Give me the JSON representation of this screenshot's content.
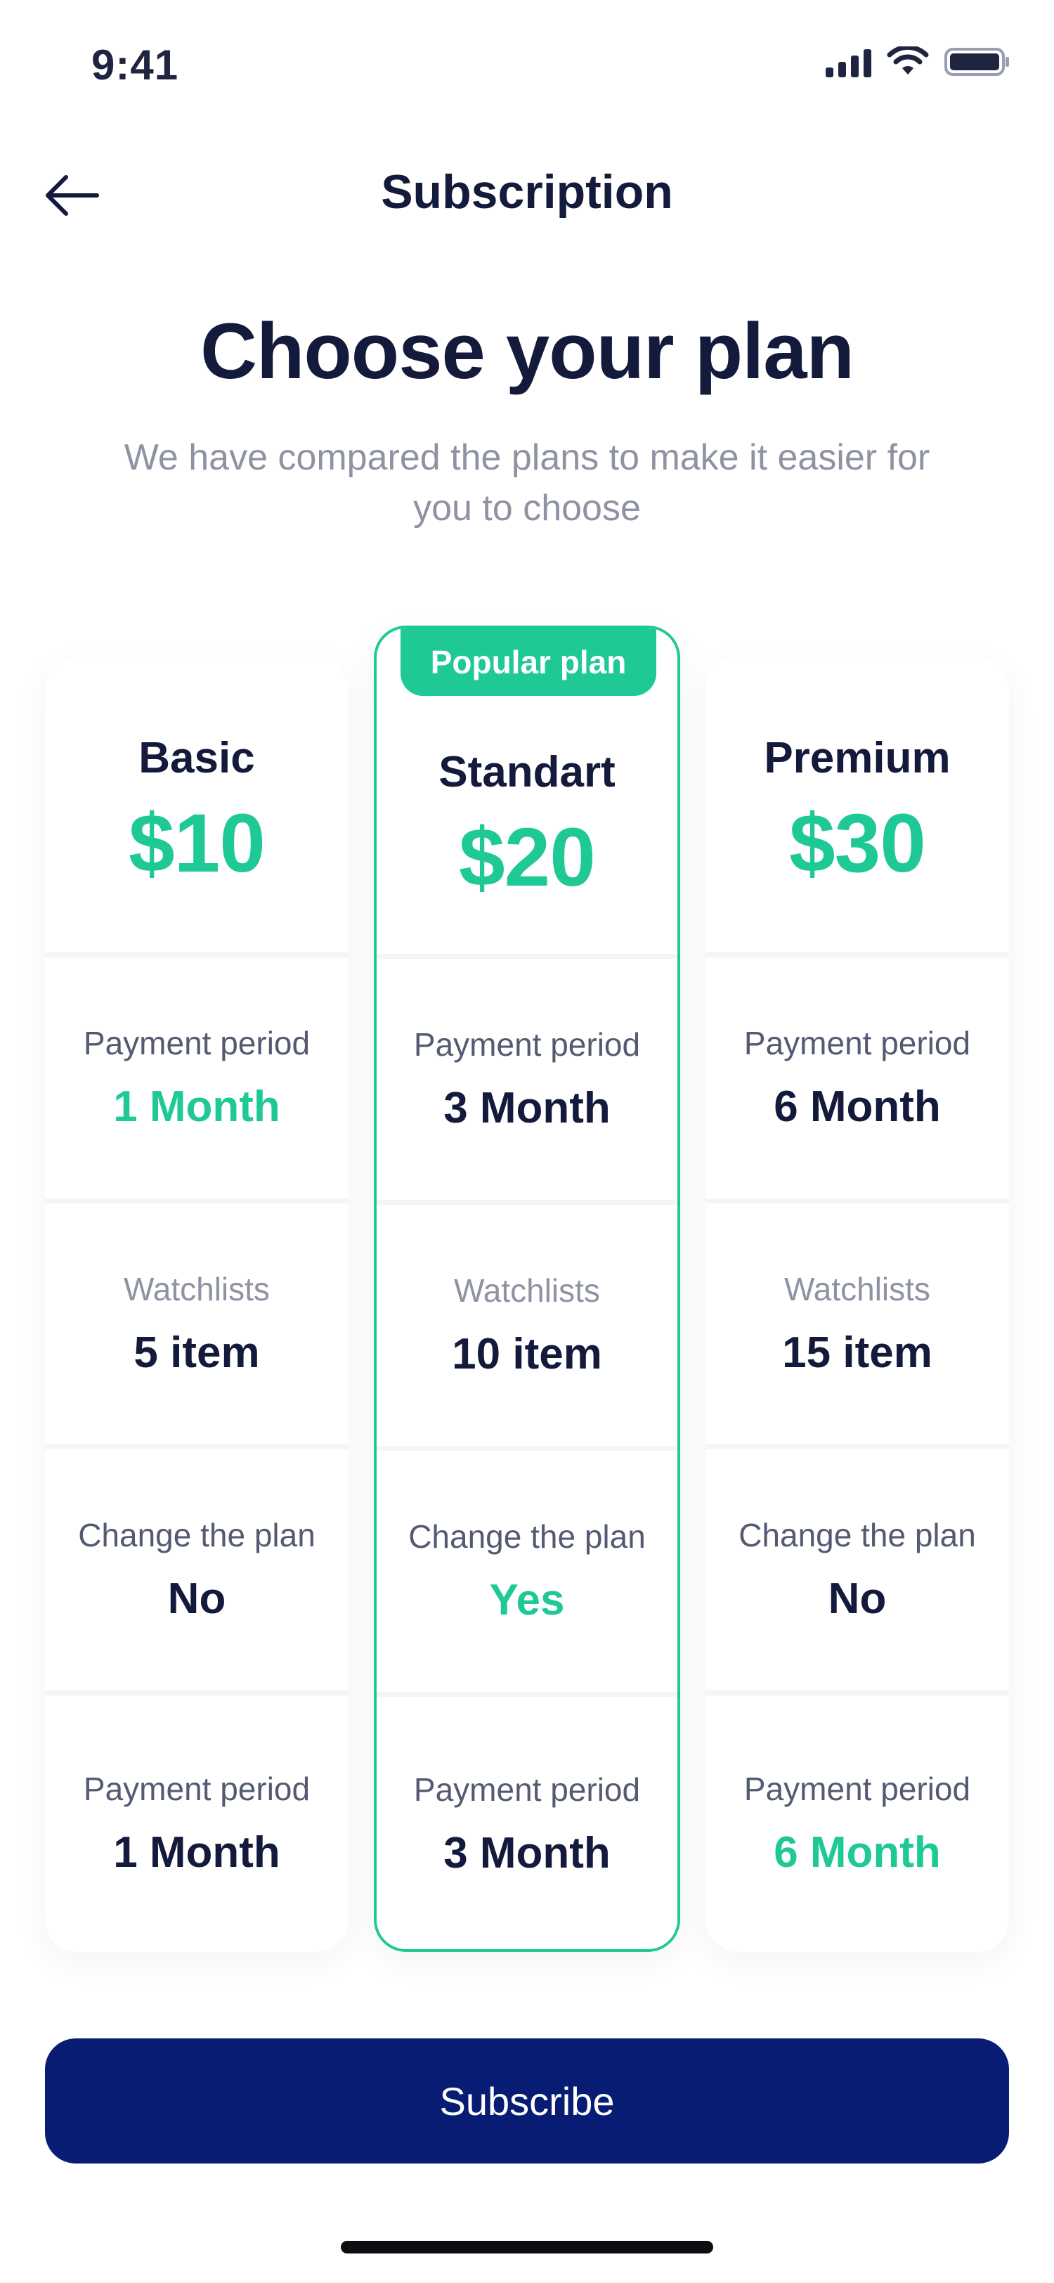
{
  "status_bar": {
    "time": "9:41"
  },
  "nav": {
    "title": "Subscription"
  },
  "header": {
    "headline": "Choose your plan",
    "subtitle": "We have compared the plans to make it easier for you to choose"
  },
  "plans": [
    {
      "name": "Basic",
      "price": "$10",
      "features": [
        {
          "label": "Payment period",
          "value": "1 Month"
        },
        {
          "label": "Watchlists",
          "value": "5 item"
        },
        {
          "label": "Change the plan",
          "value": "No"
        },
        {
          "label": "Payment period",
          "value": "1 Month"
        }
      ]
    },
    {
      "name": "Standart",
      "price": "$20",
      "badge": "Popular plan",
      "features": [
        {
          "label": "Payment period",
          "value": "3 Month"
        },
        {
          "label": "Watchlists",
          "value": "10 item"
        },
        {
          "label": "Change the plan",
          "value": "Yes"
        },
        {
          "label": "Payment period",
          "value": "3 Month"
        }
      ]
    },
    {
      "name": "Premium",
      "price": "$30",
      "features": [
        {
          "label": "Payment period",
          "value": "6 Month"
        },
        {
          "label": "Watchlists",
          "value": "15 item"
        },
        {
          "label": "Change the plan",
          "value": "No"
        },
        {
          "label": "Payment period",
          "value": "6 Month"
        }
      ]
    }
  ],
  "actions": {
    "subscribe_label": "Subscribe"
  },
  "colors": {
    "accent": "#1fc996",
    "primary_button": "#071c72",
    "text_dark": "#131a3b",
    "text_muted": "#8e92a3"
  },
  "icons": {
    "back": "arrow-left-icon",
    "signal": "cellular-signal-icon",
    "wifi": "wifi-icon",
    "battery": "battery-icon"
  }
}
